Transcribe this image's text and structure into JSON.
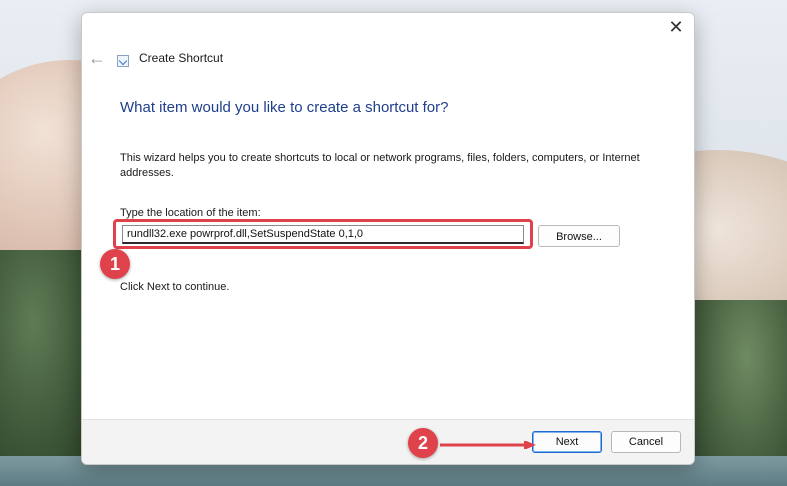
{
  "window": {
    "title": "Create Shortcut",
    "close_glyph": "✕",
    "back_glyph": "←"
  },
  "wizard": {
    "heading": "What item would you like to create a shortcut for?",
    "description": "This wizard helps you to create shortcuts to local or network programs, files, folders, computers, or Internet addresses.",
    "location_label": "Type the location of the item:",
    "location_value": "rundll32.exe powrprof.dll,SetSuspendState 0,1,0",
    "browse_label": "Browse...",
    "hint": "Click Next to continue."
  },
  "buttons": {
    "next_label": "Next",
    "cancel_label": "Cancel"
  },
  "annotations": {
    "step1": "1",
    "step2": "2",
    "highlight_color": "#e0424b"
  },
  "colors": {
    "heading": "#1e3f8b",
    "accent": "#1e6ad0"
  }
}
